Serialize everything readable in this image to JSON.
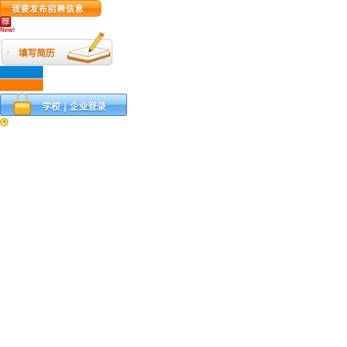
{
  "post_job": {
    "label": "我要发布招聘信息"
  },
  "badge": {
    "text": "荐"
  },
  "new_label": "New!",
  "resume": {
    "label": "填写简历",
    "arrow": "›"
  },
  "login": {
    "label": "学校 | 企业登录"
  },
  "colors": {
    "orange": "#f97800",
    "blue": "#0a83d4",
    "badge_red": "#b3141a",
    "new_red": "#d01010"
  },
  "icons": {
    "book": "book-pen-icon",
    "lock": "lock-icon",
    "clock": "clock-icon",
    "arrow": "chevron-right-icon"
  }
}
